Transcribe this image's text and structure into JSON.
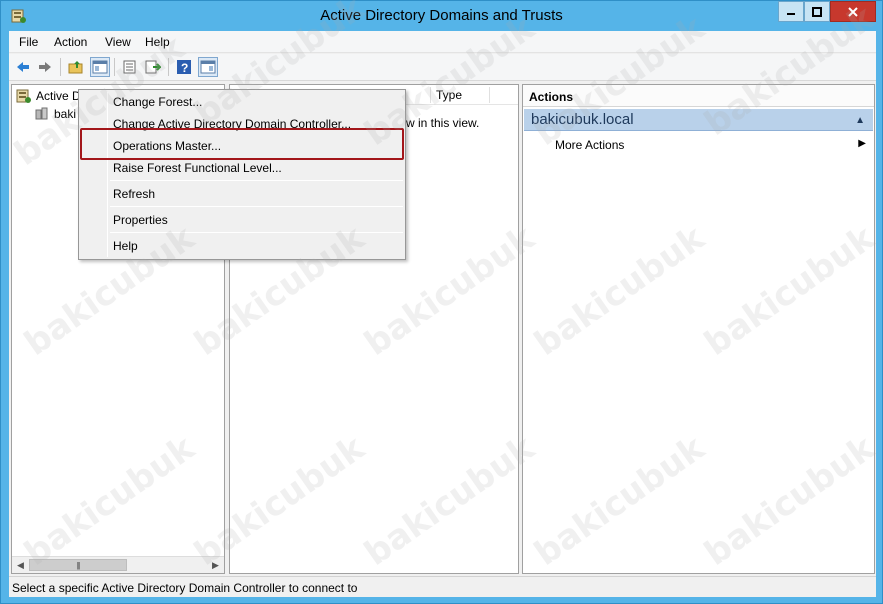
{
  "window": {
    "title": "Active Directory Domains and Trusts"
  },
  "menubar": {
    "file": "File",
    "action": "Action",
    "view": "View",
    "help": "Help"
  },
  "tree": {
    "root_label": "Active D",
    "child_label": "baki"
  },
  "center": {
    "column_type": "Type",
    "empty_text": "w in this view."
  },
  "actions": {
    "header": "Actions",
    "section_label": "bakicubuk.local",
    "more_actions": "More Actions"
  },
  "context_menu": {
    "items": [
      "Change Forest...",
      "Change Active Directory Domain Controller...",
      "Operations Master...",
      "Raise Forest Functional Level...",
      "Refresh",
      "Properties",
      "Help"
    ]
  },
  "status": {
    "text": "Select a specific Active Directory Domain Controller to connect to"
  },
  "watermark": "bakicubuk",
  "colors": {
    "highlight": "#a3161a",
    "action_section": "#b9d1ea",
    "frame": "#55b4e8"
  },
  "icons": [
    "ad-domains-icon",
    "back-icon",
    "forward-icon",
    "up-folder-icon",
    "show-hide-tree-icon",
    "export-list-icon",
    "refresh-icon",
    "help-icon",
    "properties-icon"
  ]
}
